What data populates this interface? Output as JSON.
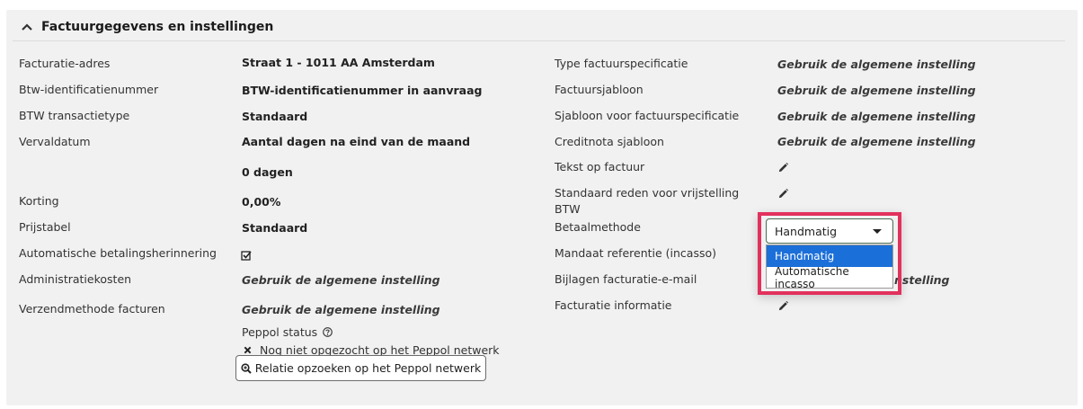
{
  "section": {
    "title": "Factuurgegevens en instellingen"
  },
  "left": {
    "facturatie_adres": {
      "label": "Facturatie-adres",
      "value": "Straat 1 - 1011 AA Amsterdam"
    },
    "btw_id": {
      "label": "Btw-identificatienummer",
      "value": "BTW-identificatienummer in aanvraag"
    },
    "btw_type": {
      "label": "BTW transactietype",
      "value": "Standaard"
    },
    "vervaldatum": {
      "label": "Vervaldatum",
      "value": "Aantal dagen na eind van de maand",
      "value2": "0 dagen"
    },
    "korting": {
      "label": "Korting",
      "value": "0,00%"
    },
    "prijstabel": {
      "label": "Prijstabel",
      "value": "Standaard"
    },
    "auto_herinnering": {
      "label": "Automatische betalingsherinnering",
      "checked": true
    },
    "admin_kosten": {
      "label": "Administratiekosten",
      "value": "Gebruik de algemene instelling"
    },
    "verzendmethode": {
      "label": "Verzendmethode facturen",
      "value": "Gebruik de algemene instelling"
    },
    "peppol": {
      "status_label": "Peppol status",
      "status_text": "Nog niet opgezocht op het Peppol netwerk",
      "button_label": "Relatie opzoeken op het Peppol netwerk"
    }
  },
  "right": {
    "type_spec": {
      "label": "Type factuurspecificatie",
      "value": "Gebruik de algemene instelling"
    },
    "factuursjabloon": {
      "label": "Factuursjabloon",
      "value": "Gebruik de algemene instelling"
    },
    "sjabloon_spec": {
      "label": "Sjabloon voor factuurspecificatie",
      "value": "Gebruik de algemene instelling"
    },
    "creditnota": {
      "label": "Creditnota sjabloon",
      "value": "Gebruik de algemene instelling"
    },
    "tekst_factuur": {
      "label": "Tekst op factuur"
    },
    "reden_vrijstelling": {
      "label_line1": "Standaard reden voor vrijstelling",
      "label_line2": "BTW"
    },
    "betaalmethode": {
      "label": "Betaalmethode",
      "selected": "Handmatig",
      "options": [
        "Handmatig",
        "Automatische incasso"
      ]
    },
    "mandaat": {
      "label": "Mandaat referentie (incasso)"
    },
    "bijlagen": {
      "label": "Bijlagen facturatie-e-mail",
      "value_partial": "nstelling"
    },
    "facturatie_info": {
      "label": "Facturatie informatie"
    }
  },
  "colors": {
    "panel_bg": "#f1f1f1",
    "highlight": "#e2315d",
    "selected_option": "#1b6fd8"
  }
}
